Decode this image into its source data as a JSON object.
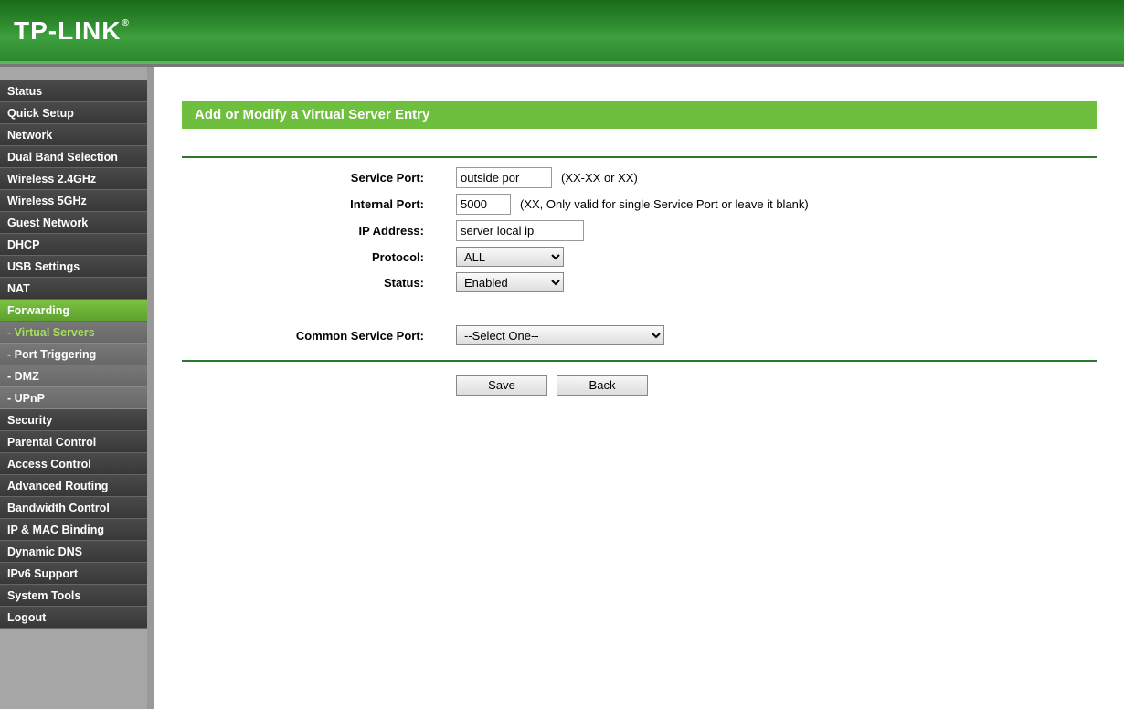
{
  "brand": "TP-LINK",
  "sidebar": {
    "items": [
      {
        "label": "Status",
        "type": "item"
      },
      {
        "label": "Quick Setup",
        "type": "item"
      },
      {
        "label": "Network",
        "type": "item"
      },
      {
        "label": "Dual Band Selection",
        "type": "item"
      },
      {
        "label": "Wireless 2.4GHz",
        "type": "item"
      },
      {
        "label": "Wireless 5GHz",
        "type": "item"
      },
      {
        "label": "Guest Network",
        "type": "item"
      },
      {
        "label": "DHCP",
        "type": "item"
      },
      {
        "label": "USB Settings",
        "type": "item"
      },
      {
        "label": "NAT",
        "type": "item"
      },
      {
        "label": "Forwarding",
        "type": "item",
        "active": true
      },
      {
        "label": "- Virtual Servers",
        "type": "sub",
        "active": true
      },
      {
        "label": "- Port Triggering",
        "type": "sub"
      },
      {
        "label": "- DMZ",
        "type": "sub"
      },
      {
        "label": "- UPnP",
        "type": "sub"
      },
      {
        "label": "Security",
        "type": "item"
      },
      {
        "label": "Parental Control",
        "type": "item"
      },
      {
        "label": "Access Control",
        "type": "item"
      },
      {
        "label": "Advanced Routing",
        "type": "item"
      },
      {
        "label": "Bandwidth Control",
        "type": "item"
      },
      {
        "label": "IP & MAC Binding",
        "type": "item"
      },
      {
        "label": "Dynamic DNS",
        "type": "item"
      },
      {
        "label": "IPv6 Support",
        "type": "item"
      },
      {
        "label": "System Tools",
        "type": "item"
      },
      {
        "label": "Logout",
        "type": "item"
      }
    ]
  },
  "panel": {
    "title": "Add or Modify a Virtual Server Entry"
  },
  "form": {
    "service_port": {
      "label": "Service Port:",
      "value": "outside por",
      "hint": "(XX-XX or XX)"
    },
    "internal_port": {
      "label": "Internal Port:",
      "value": "5000",
      "hint": "(XX, Only valid for single Service Port or leave it blank)"
    },
    "ip_address": {
      "label": "IP Address:",
      "value": "server local ip"
    },
    "protocol": {
      "label": "Protocol:",
      "value": "ALL"
    },
    "status": {
      "label": "Status:",
      "value": "Enabled"
    },
    "common_service_port": {
      "label": "Common Service Port:",
      "value": "--Select One--"
    }
  },
  "buttons": {
    "save": "Save",
    "back": "Back"
  }
}
